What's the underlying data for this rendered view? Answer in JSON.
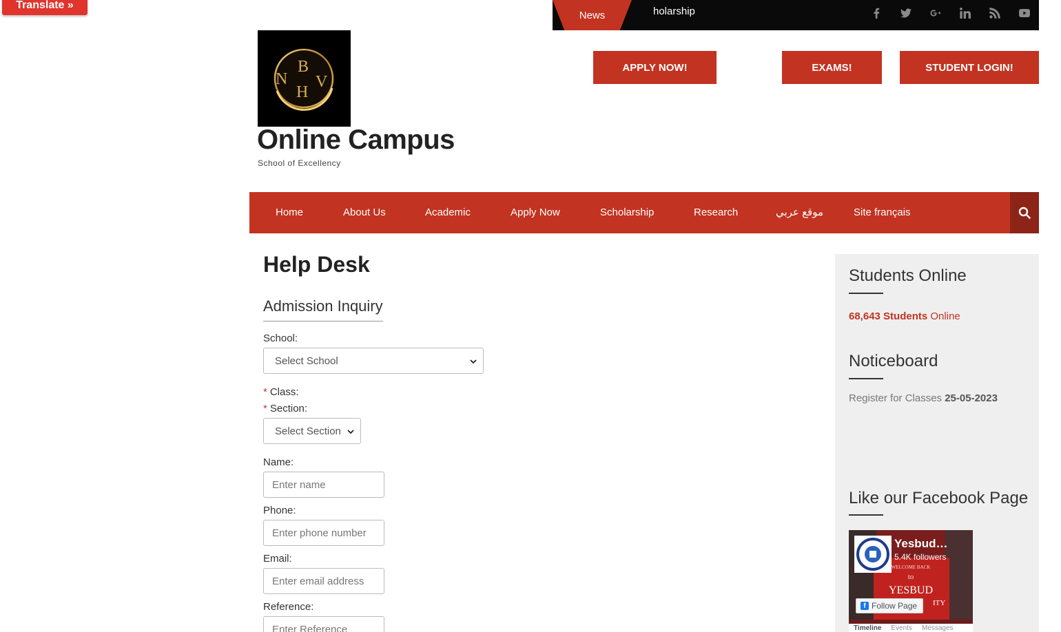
{
  "translate": {
    "label": "Translate »"
  },
  "topbar": {
    "news_label": "News",
    "ticker_text": "holarship",
    "social": [
      {
        "icon": "facebook-icon",
        "glyph": "f"
      },
      {
        "icon": "twitter-icon",
        "glyph": "t"
      },
      {
        "icon": "google-plus-icon",
        "glyph": "G+"
      },
      {
        "icon": "linkedin-icon",
        "glyph": "in"
      },
      {
        "icon": "rss-icon",
        "glyph": "rss"
      },
      {
        "icon": "youtube-icon",
        "glyph": "yt"
      }
    ]
  },
  "brand": {
    "logo_letters": [
      "N",
      "B",
      "H",
      "V"
    ],
    "title": "Online Campus",
    "tagline": "School of Excellency"
  },
  "header_buttons": {
    "apply": "APPLY NOW!",
    "exams": "EXAMS!",
    "login": "STUDENT LOGIN!"
  },
  "nav": {
    "items": [
      "Home",
      "About Us",
      "Academic",
      "Apply Now",
      "Scholarship",
      "Research",
      "موقع عربي",
      "Site français"
    ],
    "search_icon": "search-icon"
  },
  "main": {
    "page_title": "Help Desk",
    "form_title": "Admission Inquiry",
    "school_label": "School:",
    "school_value": "Select School",
    "class_label": "Class:",
    "section_label": "Section:",
    "section_value": "Select Section",
    "required_mark": "*",
    "name_label": "Name:",
    "name_placeholder": "Enter name",
    "phone_label": "Phone:",
    "phone_placeholder": "Enter phone number",
    "email_label": "Email:",
    "email_placeholder": "Enter email address",
    "reference_label": "Reference:",
    "reference_placeholder": "Enter Reference"
  },
  "sidebar": {
    "online_title": "Students Online",
    "online_count": "68,643 Students",
    "online_word": "Online",
    "notice_title": "Noticeboard",
    "notice_text": "Register for Classes",
    "notice_date": "25-05-2023",
    "fb_title": "Like our Facebook Page",
    "fb_page_name": "Yesbud…",
    "fb_followers": "5.4K followers",
    "fb_follow": "Follow Page",
    "fb_tabs": [
      "Timeline",
      "Events",
      "Messages"
    ],
    "fb_banner_text": [
      "WELCOME BACK",
      "to",
      "YESBUD",
      "ITY"
    ]
  },
  "colors": {
    "accent": "#c23321",
    "topbar": "#0a0a0a",
    "sidebar_bg": "#efefef"
  }
}
